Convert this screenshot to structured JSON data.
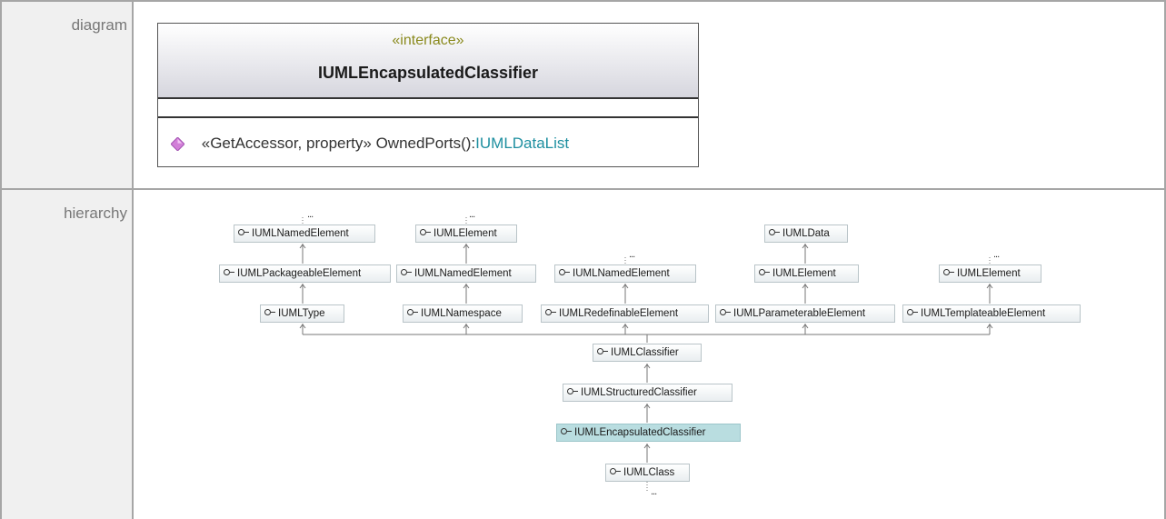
{
  "rows": {
    "diagram_label": "diagram",
    "hierarchy_label": "hierarchy"
  },
  "class_box": {
    "stereotype": "«interface»",
    "name": "IUMLEncapsulatedClassifier",
    "operation": {
      "stereotypes": "«GetAccessor, property»",
      "name": "OwnedPorts():",
      "type": "IUMLDataList"
    }
  },
  "hierarchy": {
    "nodes": [
      {
        "id": "named1",
        "label": "IUMLNamedElement"
      },
      {
        "id": "elem1",
        "label": "IUMLElement"
      },
      {
        "id": "data",
        "label": "IUMLData"
      },
      {
        "id": "pkg",
        "label": "IUMLPackageableElement"
      },
      {
        "id": "named2",
        "label": "IUMLNamedElement"
      },
      {
        "id": "named3",
        "label": "IUMLNamedElement"
      },
      {
        "id": "elem2",
        "label": "IUMLElement"
      },
      {
        "id": "elem3",
        "label": "IUMLElement"
      },
      {
        "id": "type",
        "label": "IUMLType"
      },
      {
        "id": "ns",
        "label": "IUMLNamespace"
      },
      {
        "id": "redef",
        "label": "IUMLRedefinableElement"
      },
      {
        "id": "param",
        "label": "IUMLParameterableElement"
      },
      {
        "id": "templ",
        "label": "IUMLTemplateableElement"
      },
      {
        "id": "classifier",
        "label": "IUMLClassifier"
      },
      {
        "id": "structured",
        "label": "IUMLStructuredClassifier"
      },
      {
        "id": "encap",
        "label": "IUMLEncapsulatedClassifier"
      },
      {
        "id": "class",
        "label": "IUMLClass"
      }
    ],
    "ellipsis": "..."
  },
  "colors": {
    "stereotype": "#8a8a1e",
    "type_link": "#1e8fa0",
    "selected_node": "#b9dde0",
    "operation_icon": "#d27fd8"
  }
}
